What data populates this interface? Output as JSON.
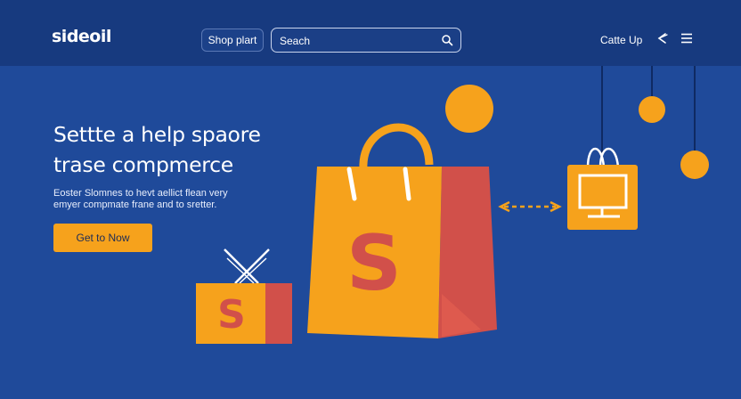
{
  "header": {
    "logo_text": "sideoil",
    "shop_button_label": "Shop plart",
    "search_placeholder": "Seach",
    "nav_link_label": "Catte Up"
  },
  "hero": {
    "headline_line1": "Settte a help spaore",
    "headline_line2": "trase compmerce",
    "subtext_line1": "Eoster Slomnes to hevt aellict flean very",
    "subtext_line2": "emyer compmate frane and to sretter.",
    "cta_label": "Get to Now"
  },
  "illustration": {
    "bag_large_symbol": "S",
    "bag_small_symbol": "S",
    "icons": [
      "shopping-bag-icon",
      "monitor-tag-icon",
      "double-arrow-icon",
      "hanging-orb-icon"
    ]
  },
  "colors": {
    "background": "#1f4a9a",
    "topbar": "#173a7f",
    "accent_orange": "#f6a21c",
    "accent_red": "#d1504a",
    "text": "#ffffff"
  }
}
